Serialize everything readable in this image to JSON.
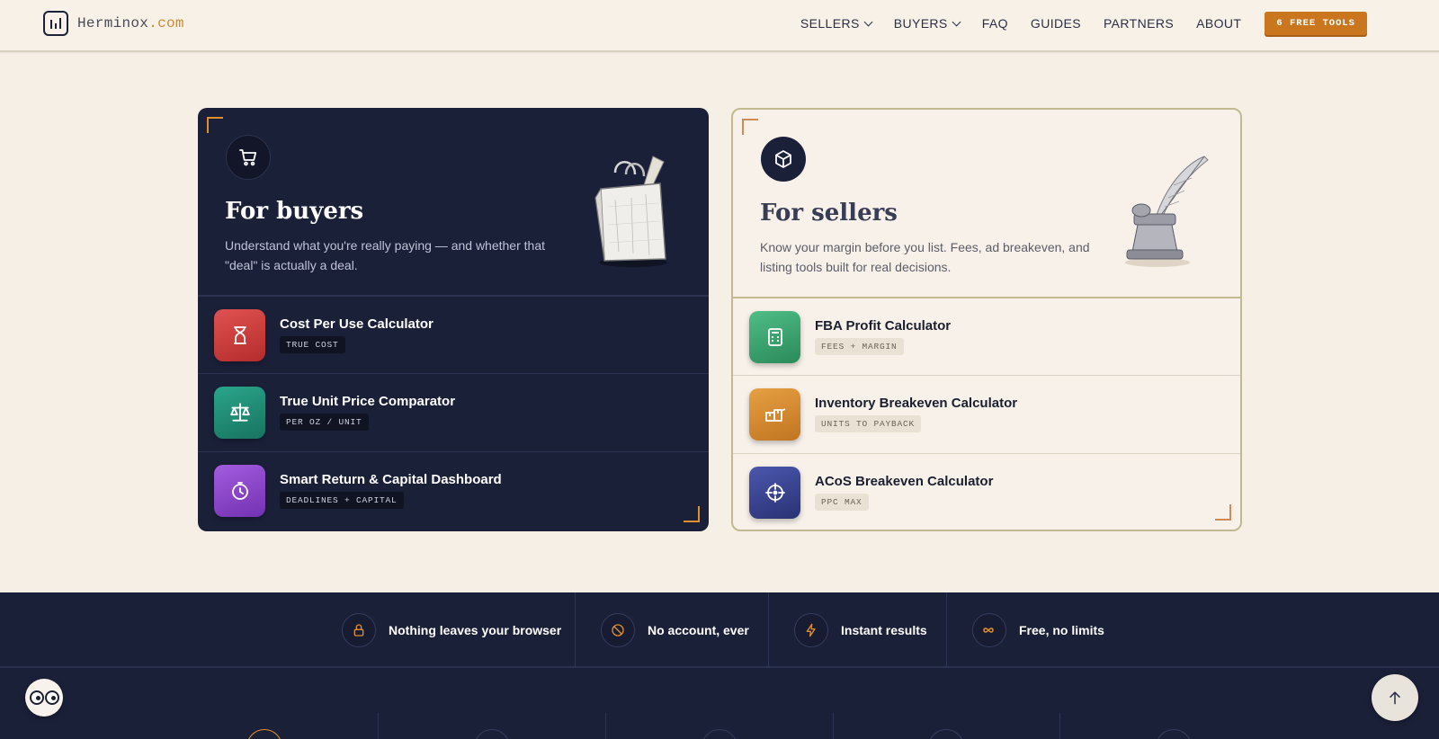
{
  "brand": {
    "name": "Herminox",
    "tld": ".com"
  },
  "nav": {
    "items": [
      {
        "label": "SELLERS",
        "dropdown": true
      },
      {
        "label": "BUYERS",
        "dropdown": true
      },
      {
        "label": "FAQ",
        "dropdown": false
      },
      {
        "label": "GUIDES",
        "dropdown": false
      },
      {
        "label": "PARTNERS",
        "dropdown": false
      },
      {
        "label": "ABOUT",
        "dropdown": false
      }
    ],
    "cta": "6 FREE TOOLS"
  },
  "buyers": {
    "title": "For buyers",
    "description": "Understand what you're really paying — and whether that \"deal\" is actually a deal.",
    "icon": "cart-icon",
    "illustration": "shopping-bag-illustration",
    "tools": [
      {
        "name": "Cost Per Use Calculator",
        "tag": "TRUE COST",
        "icon": "hourglass-icon",
        "color": "#c73b3b"
      },
      {
        "name": "True Unit Price Comparator",
        "tag": "PER OZ / UNIT",
        "icon": "scale-icon",
        "color": "#1f8d77"
      },
      {
        "name": "Smart Return & Capital Dashboard",
        "tag": "DEADLINES + CAPITAL",
        "icon": "clock-icon",
        "color": "#8b45c9"
      }
    ]
  },
  "sellers": {
    "title": "For sellers",
    "description": "Know your margin before you list. Fees, ad breakeven, and listing tools built for real decisions.",
    "icon": "box-icon",
    "illustration": "quill-inkwell-illustration",
    "tools": [
      {
        "name": "FBA Profit Calculator",
        "tag": "FEES + MARGIN",
        "icon": "calculator-icon",
        "color": "#3aa671"
      },
      {
        "name": "Inventory Breakeven Calculator",
        "tag": "UNITS TO PAYBACK",
        "icon": "inventory-icon",
        "color": "#d48a2c"
      },
      {
        "name": "ACoS Breakeven Calculator",
        "tag": "PPC MAX",
        "icon": "target-icon",
        "color": "#35408f"
      }
    ]
  },
  "features": [
    {
      "label": "Nothing leaves your browser",
      "icon": "lock-icon"
    },
    {
      "label": "No account, ever",
      "icon": "ban-icon"
    },
    {
      "label": "Instant results",
      "icon": "bolt-icon"
    },
    {
      "label": "Free, no limits",
      "icon": "infinity-icon"
    }
  ],
  "colors": {
    "accent": "#c9761f",
    "navy": "#1b2039",
    "cream": "#f6efe5"
  }
}
